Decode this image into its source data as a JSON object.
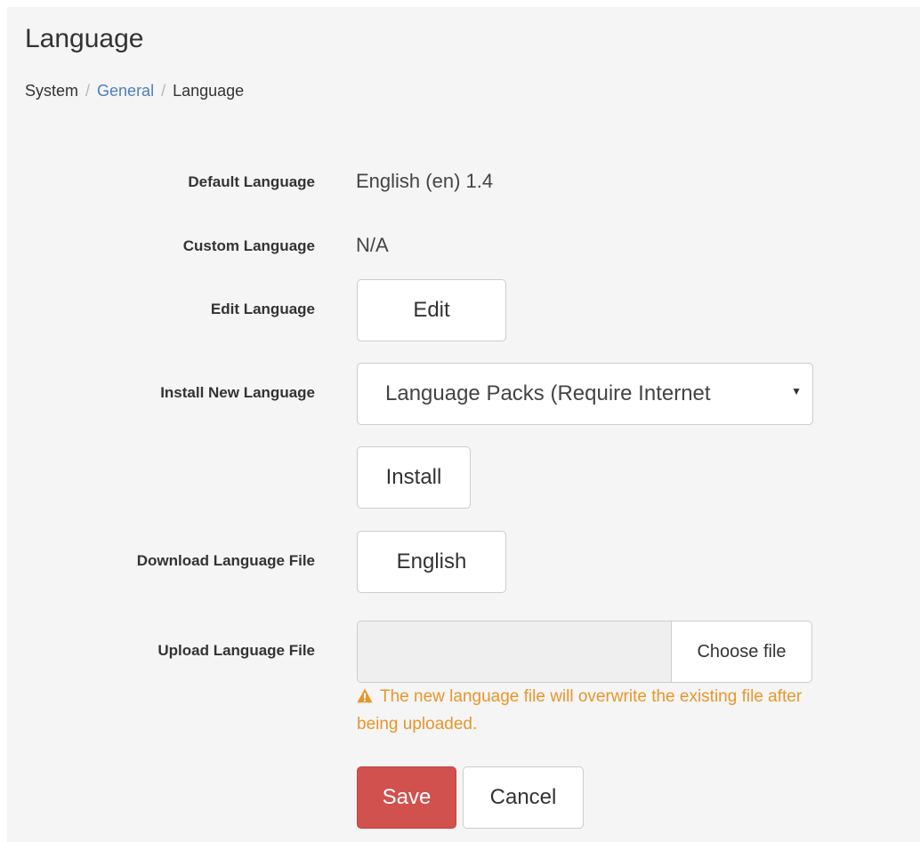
{
  "page": {
    "title": "Language"
  },
  "breadcrumb": {
    "items": [
      "System",
      "General",
      "Language"
    ],
    "separator": "/"
  },
  "form": {
    "default_language": {
      "label": "Default Language",
      "value": "English (en) 1.4"
    },
    "custom_language": {
      "label": "Custom Language",
      "value": "N/A"
    },
    "edit_language": {
      "label": "Edit Language",
      "button_label": "Edit"
    },
    "install_new_language": {
      "label": "Install New Language",
      "selected_option": "Language Packs (Require Internet",
      "install_button_label": "Install"
    },
    "download_language_file": {
      "label": "Download Language File",
      "button_label": "English"
    },
    "upload_language_file": {
      "label": "Upload Language File",
      "file_button_label": "Choose file",
      "warning": "The new language file will overwrite the existing file after being uploaded."
    },
    "actions": {
      "save_label": "Save",
      "cancel_label": "Cancel"
    }
  },
  "colors": {
    "link": "#4d7fc0",
    "warning": "#e8962b",
    "save_button": "#d0514d",
    "page_background": "#f5f5f5"
  },
  "icons": {
    "select_caret": "chevron-down-icon",
    "warning": "warning-triangle-icon"
  }
}
